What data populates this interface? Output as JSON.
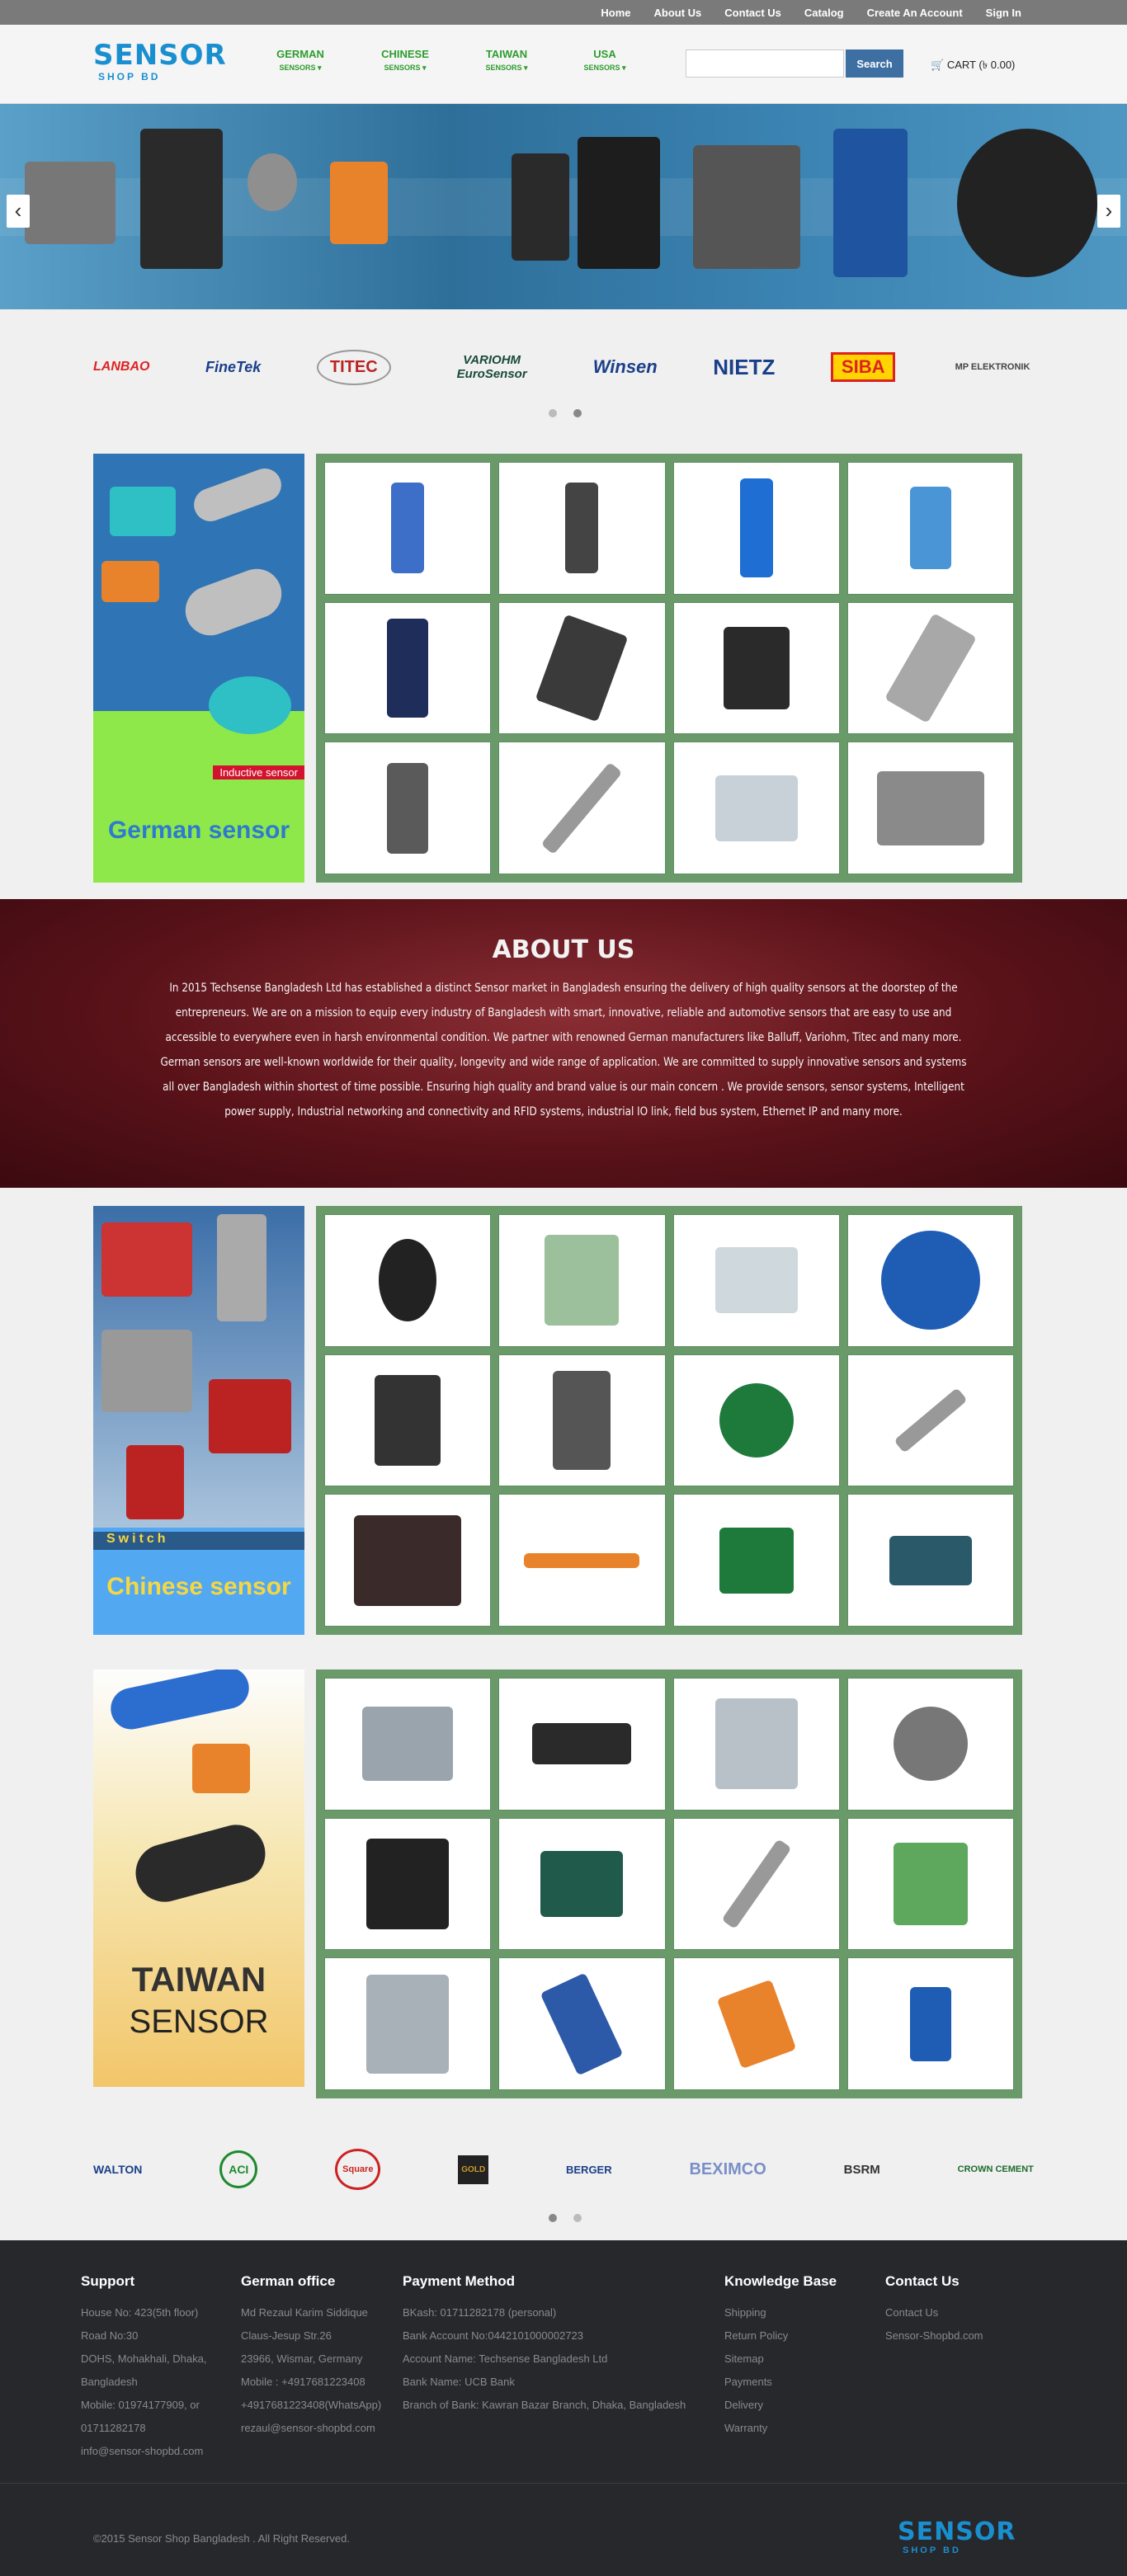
{
  "topnav": [
    "Home",
    "About Us",
    "Contact Us",
    "Catalog",
    "Create An Account",
    "Sign In"
  ],
  "logo": {
    "main": "SENSOR",
    "sub": "SHOP BD"
  },
  "mainnav": [
    {
      "label": "GERMAN",
      "sub": "SENSORS ▾"
    },
    {
      "label": "CHINESE",
      "sub": "SENSORS ▾"
    },
    {
      "label": "TAIWAN",
      "sub": "SENSORS ▾"
    },
    {
      "label": "USA",
      "sub": "SENSORS ▾"
    }
  ],
  "search": {
    "placeholder": "",
    "button": "Search"
  },
  "cart": {
    "label": "CART (৳ 0.00)"
  },
  "brands_top": [
    "LANBAO",
    "FineTek",
    "TITEC",
    "VARIOHM EuroSensor",
    "Winsen",
    "NIETZ",
    "SIBA",
    "MP ELEKTRONIK"
  ],
  "sections": {
    "german": {
      "banner_label": "German sensor",
      "banner_tag": "Inductive sensor"
    },
    "chinese": {
      "banner_label": "Chinese sensor",
      "banner_tag": "Switch"
    },
    "taiwan": {
      "banner_label1": "TAIWAN",
      "banner_label2": "SENSOR"
    }
  },
  "about": {
    "title": "ABOUT US",
    "text": "In 2015 Techsense Bangladesh Ltd has established a distinct Sensor market in Bangladesh ensuring the delivery of high quality sensors at the doorstep of the entrepreneurs. We are on a mission to equip every industry of Bangladesh with smart, innovative, reliable and automotive sensors that are easy to use and accessible to everywhere even in harsh environmental condition. We partner with renowned German manufacturers like Balluff, Variohm, Titec and many more. German sensors are well-known worldwide for their quality, longevity and wide range of application. We are committed to supply innovative sensors and systems all over Bangladesh within shortest of time possible. Ensuring high quality and brand value is our main concern . We provide sensors, sensor systems, Intelligent power supply, Industrial networking and connectivity and RFID systems, industrial IO link, field bus system, Ethernet IP and many more."
  },
  "brands_bottom": [
    "WALTON",
    "ACI",
    "Square",
    "GOLD",
    "BERGER",
    "BEXIMCO",
    "BSRM",
    "CROWN CEMENT"
  ],
  "footer": {
    "support": {
      "title": "Support",
      "lines": [
        "House No: 423(5th floor)",
        "Road No:30",
        "DOHS, Mohakhali, Dhaka,",
        "Bangladesh",
        "Mobile: 01974177909, or",
        "01711282178",
        "info@sensor-shopbd.com"
      ]
    },
    "german_office": {
      "title": "German office",
      "lines": [
        "Md Rezaul Karim Siddique",
        "Claus-Jesup Str.26",
        "23966, Wismar, Germany",
        "Mobile : +4917681223408",
        "+4917681223408(WhatsApp)",
        "rezaul@sensor-shopbd.com"
      ]
    },
    "payment": {
      "title": "Payment Method",
      "lines": [
        "BKash: 01711282178 (personal)",
        "Bank Account No:0442101000002723",
        "Account Name: Techsense Bangladesh Ltd",
        "Bank Name: UCB Bank",
        "Branch of Bank: Kawran Bazar Branch, Dhaka, Bangladesh"
      ]
    },
    "knowledge": {
      "title": "Knowledge Base",
      "lines": [
        "Shipping",
        "Return Policy",
        "Sitemap",
        "Payments",
        "Delivery",
        "Warranty"
      ]
    },
    "contact": {
      "title": "Contact Us",
      "lines": [
        "Contact Us",
        "Sensor-Shopbd.com"
      ]
    },
    "copyright": "©2015 Sensor Shop Bangladesh . All Right Reserved."
  },
  "colors": {
    "accent_green": "#2e9c2e",
    "grid_green": "#6a9a6a",
    "search_blue": "#3e6fa3",
    "logo_blue": "#1a8fd0",
    "about_red": "#5a1219",
    "footer_bg": "#26282c"
  }
}
